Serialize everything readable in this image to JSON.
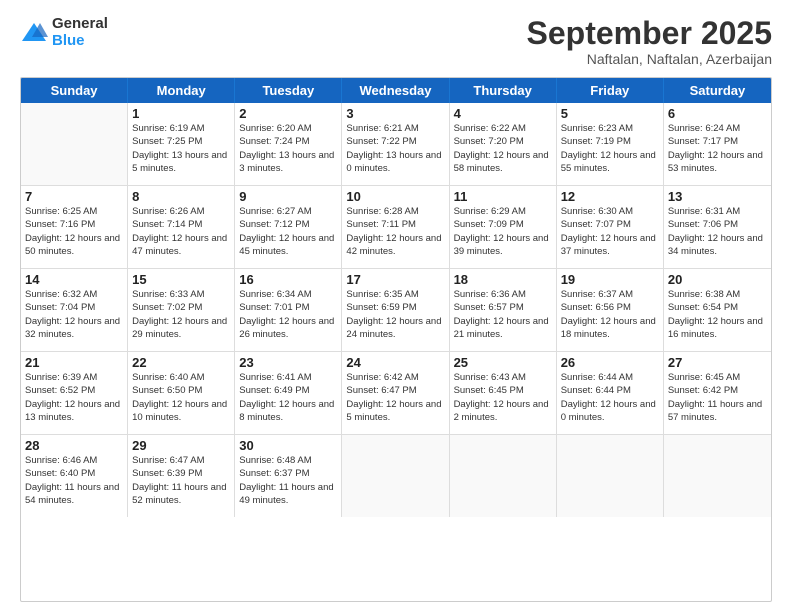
{
  "logo": {
    "general": "General",
    "blue": "Blue"
  },
  "header": {
    "month": "September 2025",
    "location": "Naftalan, Naftalan, Azerbaijan"
  },
  "days_of_week": [
    "Sunday",
    "Monday",
    "Tuesday",
    "Wednesday",
    "Thursday",
    "Friday",
    "Saturday"
  ],
  "weeks": [
    [
      {
        "day": "",
        "sunrise": "",
        "sunset": "",
        "daylight": ""
      },
      {
        "day": "1",
        "sunrise": "Sunrise: 6:19 AM",
        "sunset": "Sunset: 7:25 PM",
        "daylight": "Daylight: 13 hours and 5 minutes."
      },
      {
        "day": "2",
        "sunrise": "Sunrise: 6:20 AM",
        "sunset": "Sunset: 7:24 PM",
        "daylight": "Daylight: 13 hours and 3 minutes."
      },
      {
        "day": "3",
        "sunrise": "Sunrise: 6:21 AM",
        "sunset": "Sunset: 7:22 PM",
        "daylight": "Daylight: 13 hours and 0 minutes."
      },
      {
        "day": "4",
        "sunrise": "Sunrise: 6:22 AM",
        "sunset": "Sunset: 7:20 PM",
        "daylight": "Daylight: 12 hours and 58 minutes."
      },
      {
        "day": "5",
        "sunrise": "Sunrise: 6:23 AM",
        "sunset": "Sunset: 7:19 PM",
        "daylight": "Daylight: 12 hours and 55 minutes."
      },
      {
        "day": "6",
        "sunrise": "Sunrise: 6:24 AM",
        "sunset": "Sunset: 7:17 PM",
        "daylight": "Daylight: 12 hours and 53 minutes."
      }
    ],
    [
      {
        "day": "7",
        "sunrise": "Sunrise: 6:25 AM",
        "sunset": "Sunset: 7:16 PM",
        "daylight": "Daylight: 12 hours and 50 minutes."
      },
      {
        "day": "8",
        "sunrise": "Sunrise: 6:26 AM",
        "sunset": "Sunset: 7:14 PM",
        "daylight": "Daylight: 12 hours and 47 minutes."
      },
      {
        "day": "9",
        "sunrise": "Sunrise: 6:27 AM",
        "sunset": "Sunset: 7:12 PM",
        "daylight": "Daylight: 12 hours and 45 minutes."
      },
      {
        "day": "10",
        "sunrise": "Sunrise: 6:28 AM",
        "sunset": "Sunset: 7:11 PM",
        "daylight": "Daylight: 12 hours and 42 minutes."
      },
      {
        "day": "11",
        "sunrise": "Sunrise: 6:29 AM",
        "sunset": "Sunset: 7:09 PM",
        "daylight": "Daylight: 12 hours and 39 minutes."
      },
      {
        "day": "12",
        "sunrise": "Sunrise: 6:30 AM",
        "sunset": "Sunset: 7:07 PM",
        "daylight": "Daylight: 12 hours and 37 minutes."
      },
      {
        "day": "13",
        "sunrise": "Sunrise: 6:31 AM",
        "sunset": "Sunset: 7:06 PM",
        "daylight": "Daylight: 12 hours and 34 minutes."
      }
    ],
    [
      {
        "day": "14",
        "sunrise": "Sunrise: 6:32 AM",
        "sunset": "Sunset: 7:04 PM",
        "daylight": "Daylight: 12 hours and 32 minutes."
      },
      {
        "day": "15",
        "sunrise": "Sunrise: 6:33 AM",
        "sunset": "Sunset: 7:02 PM",
        "daylight": "Daylight: 12 hours and 29 minutes."
      },
      {
        "day": "16",
        "sunrise": "Sunrise: 6:34 AM",
        "sunset": "Sunset: 7:01 PM",
        "daylight": "Daylight: 12 hours and 26 minutes."
      },
      {
        "day": "17",
        "sunrise": "Sunrise: 6:35 AM",
        "sunset": "Sunset: 6:59 PM",
        "daylight": "Daylight: 12 hours and 24 minutes."
      },
      {
        "day": "18",
        "sunrise": "Sunrise: 6:36 AM",
        "sunset": "Sunset: 6:57 PM",
        "daylight": "Daylight: 12 hours and 21 minutes."
      },
      {
        "day": "19",
        "sunrise": "Sunrise: 6:37 AM",
        "sunset": "Sunset: 6:56 PM",
        "daylight": "Daylight: 12 hours and 18 minutes."
      },
      {
        "day": "20",
        "sunrise": "Sunrise: 6:38 AM",
        "sunset": "Sunset: 6:54 PM",
        "daylight": "Daylight: 12 hours and 16 minutes."
      }
    ],
    [
      {
        "day": "21",
        "sunrise": "Sunrise: 6:39 AM",
        "sunset": "Sunset: 6:52 PM",
        "daylight": "Daylight: 12 hours and 13 minutes."
      },
      {
        "day": "22",
        "sunrise": "Sunrise: 6:40 AM",
        "sunset": "Sunset: 6:50 PM",
        "daylight": "Daylight: 12 hours and 10 minutes."
      },
      {
        "day": "23",
        "sunrise": "Sunrise: 6:41 AM",
        "sunset": "Sunset: 6:49 PM",
        "daylight": "Daylight: 12 hours and 8 minutes."
      },
      {
        "day": "24",
        "sunrise": "Sunrise: 6:42 AM",
        "sunset": "Sunset: 6:47 PM",
        "daylight": "Daylight: 12 hours and 5 minutes."
      },
      {
        "day": "25",
        "sunrise": "Sunrise: 6:43 AM",
        "sunset": "Sunset: 6:45 PM",
        "daylight": "Daylight: 12 hours and 2 minutes."
      },
      {
        "day": "26",
        "sunrise": "Sunrise: 6:44 AM",
        "sunset": "Sunset: 6:44 PM",
        "daylight": "Daylight: 12 hours and 0 minutes."
      },
      {
        "day": "27",
        "sunrise": "Sunrise: 6:45 AM",
        "sunset": "Sunset: 6:42 PM",
        "daylight": "Daylight: 11 hours and 57 minutes."
      }
    ],
    [
      {
        "day": "28",
        "sunrise": "Sunrise: 6:46 AM",
        "sunset": "Sunset: 6:40 PM",
        "daylight": "Daylight: 11 hours and 54 minutes."
      },
      {
        "day": "29",
        "sunrise": "Sunrise: 6:47 AM",
        "sunset": "Sunset: 6:39 PM",
        "daylight": "Daylight: 11 hours and 52 minutes."
      },
      {
        "day": "30",
        "sunrise": "Sunrise: 6:48 AM",
        "sunset": "Sunset: 6:37 PM",
        "daylight": "Daylight: 11 hours and 49 minutes."
      },
      {
        "day": "",
        "sunrise": "",
        "sunset": "",
        "daylight": ""
      },
      {
        "day": "",
        "sunrise": "",
        "sunset": "",
        "daylight": ""
      },
      {
        "day": "",
        "sunrise": "",
        "sunset": "",
        "daylight": ""
      },
      {
        "day": "",
        "sunrise": "",
        "sunset": "",
        "daylight": ""
      }
    ]
  ]
}
